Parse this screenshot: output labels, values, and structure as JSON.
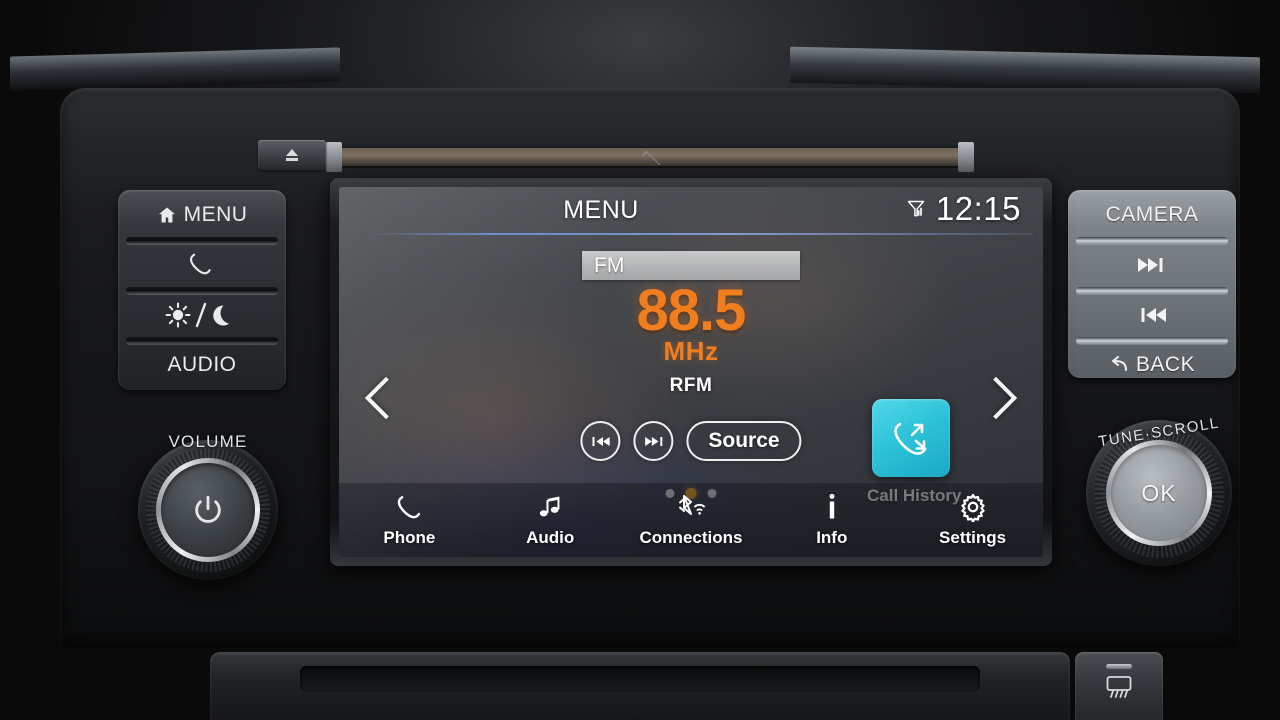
{
  "head_unit": {
    "eject_button": {
      "icon": "eject-icon"
    },
    "cd_slot": {
      "label": ""
    }
  },
  "left_buttons": [
    {
      "id": "menu",
      "label": "MENU",
      "icon": "home-icon"
    },
    {
      "id": "phone",
      "label": "",
      "icon": "phone-handset-icon"
    },
    {
      "id": "daynight",
      "label": "",
      "icon": "sun-moon-icon"
    },
    {
      "id": "audio",
      "label": "AUDIO",
      "icon": ""
    }
  ],
  "right_buttons": [
    {
      "id": "camera",
      "label": "CAMERA",
      "icon": ""
    },
    {
      "id": "next",
      "label": "",
      "icon": "next-track-icon"
    },
    {
      "id": "previous",
      "label": "",
      "icon": "prev-track-icon"
    },
    {
      "id": "back",
      "label": "BACK",
      "icon": "back-arrow-icon"
    }
  ],
  "knobs": {
    "volume": {
      "label": "VOLUME",
      "center_icon": "power-icon"
    },
    "tune": {
      "label": "TUNE·SCROLL",
      "center_label": "OK"
    }
  },
  "screen": {
    "title": "MENU",
    "clock": "12:15",
    "signal_icon": "antenna-signal-icon",
    "band": "FM",
    "frequency": "88.5",
    "frequency_unit": "MHz",
    "station_name": "RFM",
    "transport": {
      "previous_label": "",
      "next_label": "",
      "source_label": "Source"
    },
    "arrows": {
      "prev_icon": "chevron-left-icon",
      "next_icon": "chevron-right-icon"
    },
    "widget": {
      "label": "Call History",
      "icon": "call-history-icon",
      "tile_color": "#2ec3d8"
    },
    "page_dots": {
      "count": 3,
      "active_index": 1,
      "active_color": "#f5a623",
      "inactive_color": "#dfe2e6"
    },
    "bottom_nav": [
      {
        "id": "phone",
        "label": "Phone",
        "icon": "phone-handset-icon"
      },
      {
        "id": "audio",
        "label": "Audio",
        "icon": "music-note-icon"
      },
      {
        "id": "connections",
        "label": "Connections",
        "icon": "bluetooth-wifi-icon"
      },
      {
        "id": "info",
        "label": "Info",
        "icon": "info-icon"
      },
      {
        "id": "settings",
        "label": "Settings",
        "icon": "gear-icon"
      }
    ],
    "accent_orange": "#f07d1e"
  },
  "dash": {
    "defrost_button": {
      "icon": "rear-defrost-icon"
    }
  }
}
